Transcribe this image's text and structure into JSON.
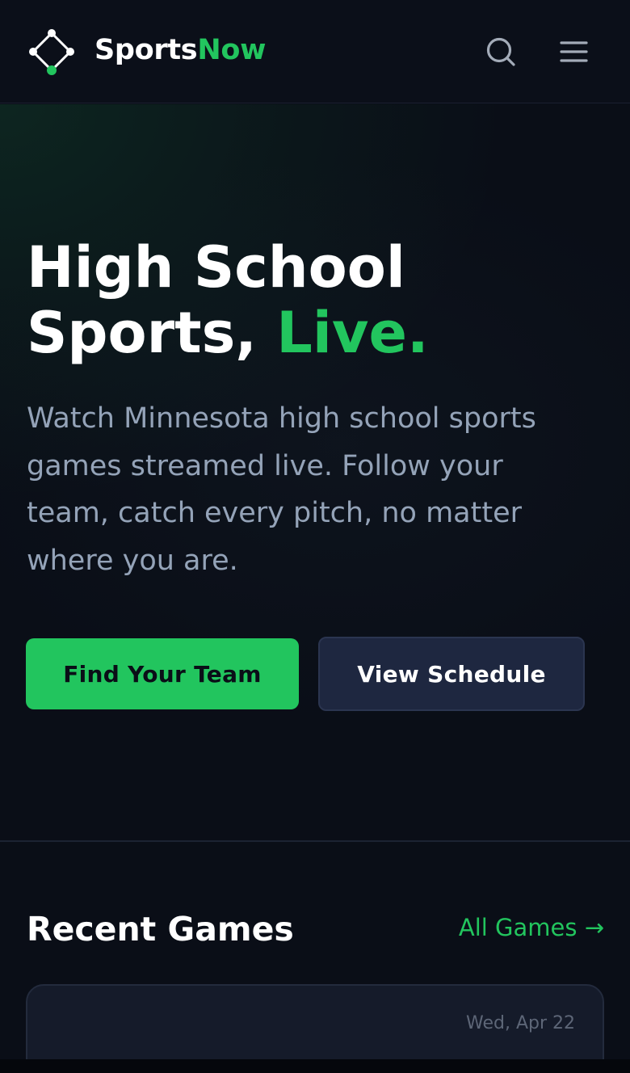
{
  "header": {
    "brand_part1": "Sports",
    "brand_part2": "Now",
    "brand_accent_color": "#22c55e",
    "logo_icon": "diamond-field-icon",
    "search_icon": "search-icon",
    "menu_icon": "hamburger-menu-icon"
  },
  "hero": {
    "title_line1": "High School",
    "title_line2_plain": "Sports, ",
    "title_line2_accent": "Live.",
    "description": "Watch Minnesota high school sports games streamed live. Follow your team, catch every pitch, no matter where you are.",
    "primary_button": "Find Your Team",
    "secondary_button": "View Schedule"
  },
  "recent_games": {
    "title": "Recent Games",
    "link_label": "All Games →",
    "cards": [
      {
        "date": "Wed, Apr 22"
      }
    ]
  },
  "colors": {
    "background": "#0a0e17",
    "accent": "#22c55e",
    "muted_text": "#94a3b8",
    "secondary_button": "#1e2740"
  }
}
